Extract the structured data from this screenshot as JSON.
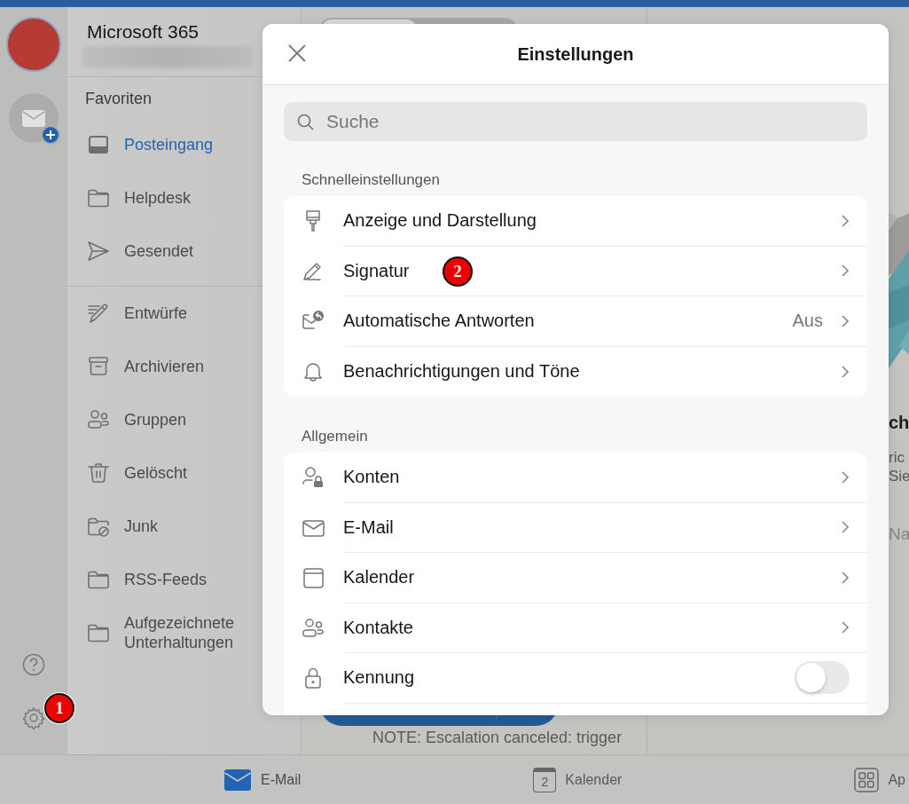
{
  "rail": {
    "gear_badge": "1"
  },
  "account": {
    "title": "Microsoft 365"
  },
  "favorites": {
    "heading": "Favoriten",
    "items": [
      {
        "label": "Posteingang",
        "selected": true
      },
      {
        "label": "Helpdesk",
        "selected": false
      },
      {
        "label": "Gesendet",
        "selected": false
      }
    ]
  },
  "folders": [
    {
      "label": "Entwürfe",
      "selected": false
    },
    {
      "label": "Archivieren",
      "selected": false
    },
    {
      "label": "Gruppen",
      "selected": false
    },
    {
      "label": "Gelöscht",
      "selected": false
    },
    {
      "label": "Junk",
      "selected": false
    },
    {
      "label": "RSS-Feeds",
      "selected": false
    },
    {
      "label": "Aufgezeichnete Unterhaltungen",
      "selected": false
    }
  ],
  "message_list": {
    "view_switch": [
      {
        "selected": true
      },
      {
        "selected": false
      }
    ],
    "preview_line": "NOTE: Escalation canceled: trigger"
  },
  "reading_pane": {
    "heading": "ch",
    "lines": [
      "ric",
      "Sie"
    ],
    "link": "Na"
  },
  "settings": {
    "title": "Einstellungen",
    "search": {
      "placeholder": "Suche"
    },
    "sections": [
      {
        "heading": "Schnelleinstellungen",
        "rows": [
          {
            "kind": "link",
            "label": "Anzeige und Darstellung"
          },
          {
            "kind": "link",
            "label": "Signatur",
            "badge": "2"
          },
          {
            "kind": "link",
            "label": "Automatische Antworten",
            "value": "Aus"
          },
          {
            "kind": "link",
            "label": "Benachrichtigungen und Töne"
          }
        ]
      },
      {
        "heading": "Allgemein",
        "rows": [
          {
            "kind": "link",
            "label": "Konten"
          },
          {
            "kind": "link",
            "label": "E-Mail"
          },
          {
            "kind": "link",
            "label": "Kalender"
          },
          {
            "kind": "link",
            "label": "Kontakte"
          },
          {
            "kind": "toggle",
            "label": "Kennung",
            "on": false
          }
        ]
      }
    ]
  },
  "tab_bar": [
    {
      "label": "E-Mail",
      "selected": true
    },
    {
      "label": "Kalender",
      "selected": false,
      "icon_day": "2"
    },
    {
      "label": "Ap",
      "selected": false
    }
  ]
}
